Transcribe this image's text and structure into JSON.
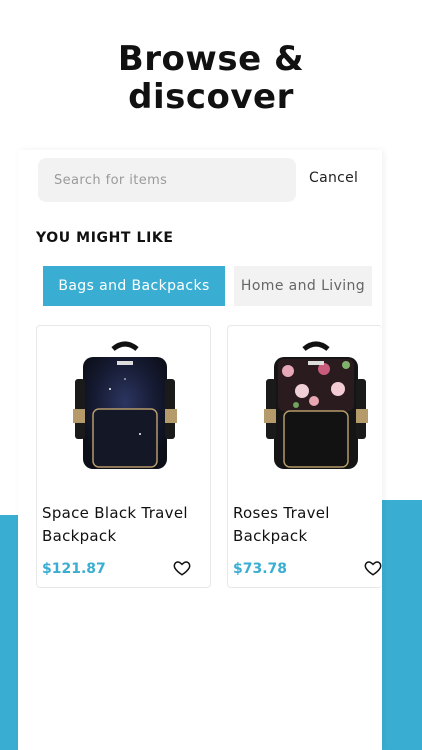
{
  "headline": {
    "line1": "Browse &",
    "line2": "discover"
  },
  "search": {
    "placeholder": "Search for items",
    "cancel_label": "Cancel"
  },
  "section_title": "YOU MIGHT LIKE",
  "categories": [
    {
      "label": "Bags and Backpacks",
      "active": true
    },
    {
      "label": "Home and Living",
      "active": false
    }
  ],
  "products": [
    {
      "name": "Space Black Travel Backpack",
      "price": "$121.87",
      "icon": "heart-outline-icon"
    },
    {
      "name": "Roses Travel Backpack",
      "price": "$73.78",
      "icon": "heart-outline-icon"
    }
  ],
  "colors": {
    "accent": "#3aaed2",
    "search_bg": "#f2f2f2"
  }
}
